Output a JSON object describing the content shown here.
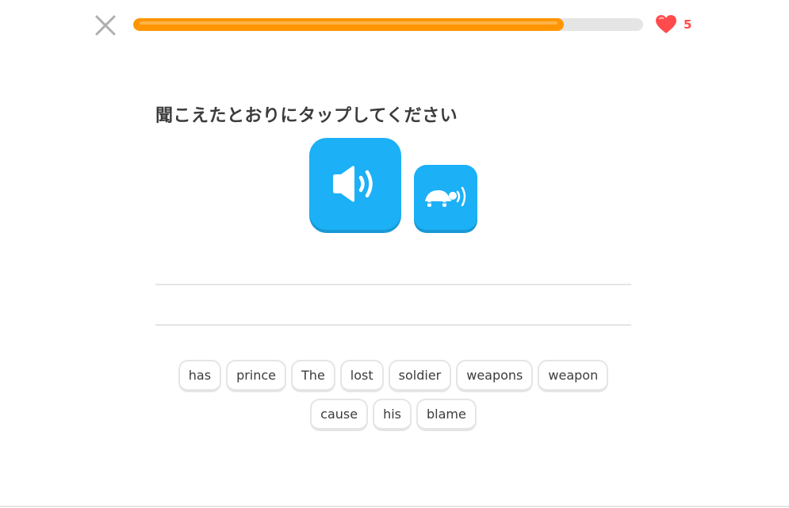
{
  "header": {
    "close_icon": "close-icon",
    "progress_fraction": 0.845,
    "progress_color": "#ff9600",
    "hearts_icon": "heart-icon",
    "hearts_count": "5",
    "hearts_color": "#ff4b4b"
  },
  "challenge": {
    "prompt": "聞こえたとおりにタップしてください",
    "audio_button_icon": "speaker-icon",
    "slow_audio_button_icon": "turtle-speaker-icon",
    "accent_color": "#1cb0f6"
  },
  "word_bank": {
    "words": [
      "has",
      "prince",
      "The",
      "lost",
      "soldier",
      "weapons",
      "weapon",
      "cause",
      "his",
      "blame"
    ]
  }
}
